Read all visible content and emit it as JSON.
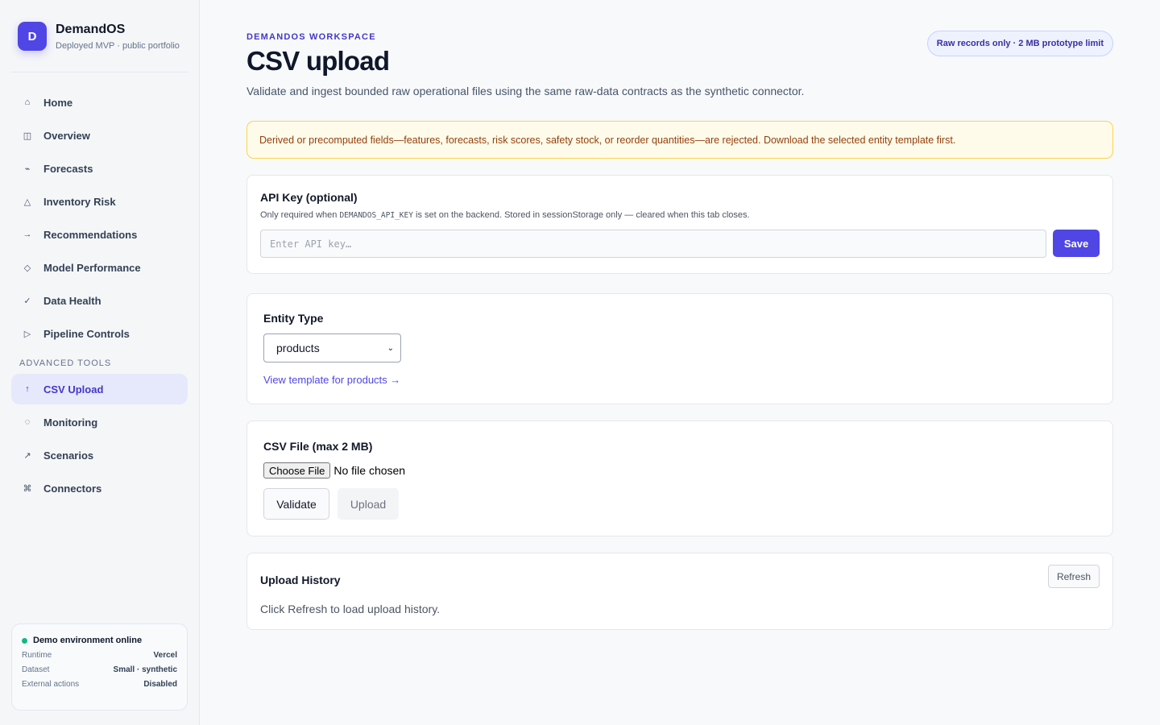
{
  "brand": {
    "logo_letter": "D",
    "name": "DemandOS",
    "subtitle": "Deployed MVP · public portfolio",
    "accent": "#4f46e5"
  },
  "sidebar": {
    "items": [
      {
        "label": "Home",
        "icon": "home-icon",
        "glyph": "⌂"
      },
      {
        "label": "Overview",
        "icon": "layout-icon",
        "glyph": "◫"
      },
      {
        "label": "Forecasts",
        "icon": "trend-icon",
        "glyph": "⌁"
      },
      {
        "label": "Inventory Risk",
        "icon": "warning-triangle-icon",
        "glyph": "△"
      },
      {
        "label": "Recommendations",
        "icon": "arrow-right-icon",
        "glyph": "→"
      },
      {
        "label": "Model Performance",
        "icon": "diamond-icon",
        "glyph": "◇"
      },
      {
        "label": "Data Health",
        "icon": "check-icon",
        "glyph": "✓"
      },
      {
        "label": "Pipeline Controls",
        "icon": "play-icon",
        "glyph": "▷"
      }
    ],
    "section_label": "ADVANCED TOOLS",
    "advanced_items": [
      {
        "label": "CSV Upload",
        "icon": "arrow-up-icon",
        "glyph": "↑",
        "active": true
      },
      {
        "label": "Monitoring",
        "icon": "monitor-ring-icon",
        "glyph": "◌"
      },
      {
        "label": "Scenarios",
        "icon": "arrow-up-right-icon",
        "glyph": "↗"
      },
      {
        "label": "Connectors",
        "icon": "command-icon",
        "glyph": "⌘"
      }
    ]
  },
  "status_card": {
    "title": "Demo environment online",
    "status_color": "#10b981",
    "rows": [
      {
        "key": "Runtime",
        "value": "Vercel"
      },
      {
        "key": "Dataset",
        "value": "Small · synthetic"
      },
      {
        "key": "External actions",
        "value": "Disabled"
      }
    ]
  },
  "header": {
    "eyebrow": "DEMANDOS WORKSPACE",
    "title": "CSV upload",
    "subtitle": "Validate and ingest bounded raw operational files using the same raw-data contracts as the synthetic connector.",
    "pill": "Raw records only · 2 MB prototype limit"
  },
  "alert": {
    "text": "Derived or precomputed fields—features, forecasts, risk scores, safety stock, or reorder quantities—are rejected. Download the selected entity template first."
  },
  "api_key": {
    "title": "API Key (optional)",
    "help_prefix": "Only required when ",
    "help_code": "DEMANDOS_API_KEY",
    "help_suffix": " is set on the backend. Stored in sessionStorage only — cleared when this tab closes.",
    "placeholder": "Enter API key…",
    "value": "",
    "save_label": "Save"
  },
  "entity": {
    "label": "Entity Type",
    "selected": "products",
    "template_link": "View template for products →"
  },
  "csv_file": {
    "label": "CSV File (max 2 MB)",
    "choose_label": "Choose File",
    "file_status": "No file chosen",
    "validate_label": "Validate",
    "upload_label": "Upload"
  },
  "history": {
    "title": "Upload History",
    "refresh_label": "Refresh",
    "empty_text": "Click Refresh to load upload history."
  }
}
